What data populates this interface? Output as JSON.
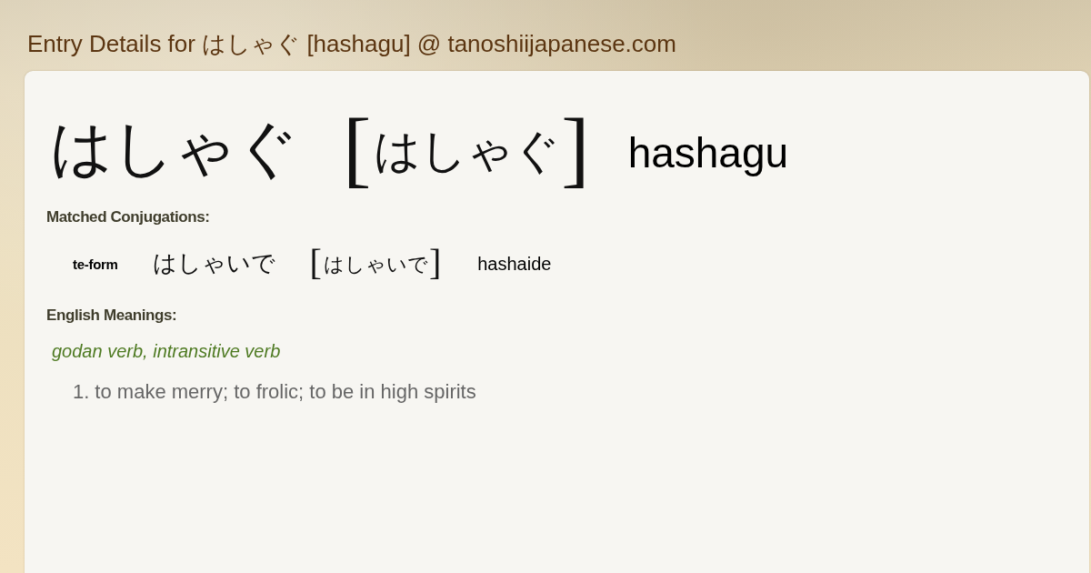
{
  "page_title": "Entry Details for はしゃぐ [hashagu] @ tanoshiijapanese.com",
  "entry": {
    "word": "はしゃぐ",
    "reading": {
      "open": "[",
      "kana": "はしゃぐ",
      "close": "]"
    },
    "romaji": "hashagu"
  },
  "conjugations": {
    "heading": "Matched Conjugations:",
    "rows": [
      {
        "form": "te-form",
        "word": "はしゃいで",
        "reading": {
          "open": "[",
          "kana": "はしゃいで",
          "close": "]"
        },
        "romaji": "hashaide"
      }
    ]
  },
  "meanings": {
    "heading": "English Meanings:",
    "part_of_speech": "godan verb, intransitive verb",
    "senses": [
      {
        "number": "1.",
        "text": "to make merry; to frolic; to be in high spirits"
      }
    ]
  }
}
